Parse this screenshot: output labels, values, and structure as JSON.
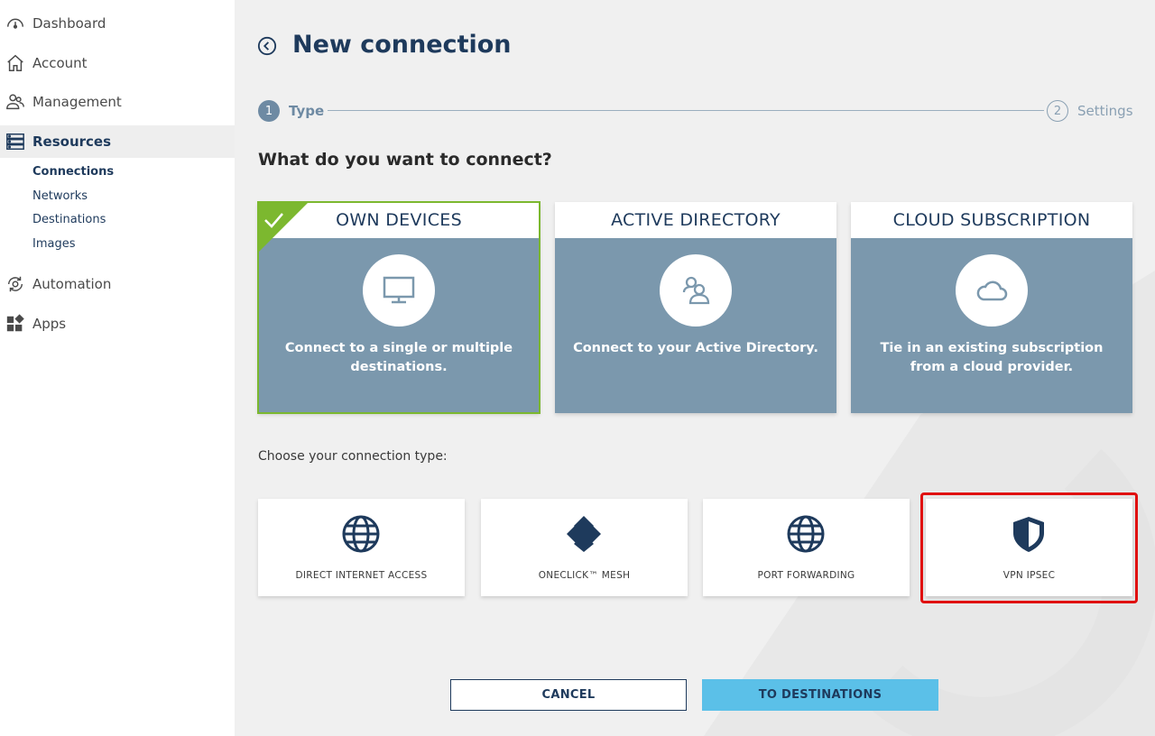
{
  "sidebar": {
    "items": [
      {
        "label": "Dashboard",
        "icon": "gauge-icon"
      },
      {
        "label": "Account",
        "icon": "home-icon"
      },
      {
        "label": "Management",
        "icon": "users-icon"
      },
      {
        "label": "Resources",
        "icon": "server-icon",
        "active": true
      },
      {
        "label": "Automation",
        "icon": "automation-icon"
      },
      {
        "label": "Apps",
        "icon": "apps-icon"
      }
    ],
    "sub_items": [
      {
        "label": "Connections",
        "active": true
      },
      {
        "label": "Networks"
      },
      {
        "label": "Destinations"
      },
      {
        "label": "Images"
      }
    ]
  },
  "header": {
    "title": "New connection"
  },
  "steps": [
    {
      "number": "1",
      "label": "Type",
      "active": true
    },
    {
      "number": "2",
      "label": "Settings",
      "active": false
    }
  ],
  "question": "What do you want to connect?",
  "cards": [
    {
      "title": "OWN DEVICES",
      "description": "Connect to a single or multiple destinations.",
      "icon": "monitor-icon",
      "selected": true
    },
    {
      "title": "ACTIVE DIRECTORY",
      "description": "Connect to your Active Directory.",
      "icon": "users-icon",
      "selected": false
    },
    {
      "title": "CLOUD SUBSCRIPTION",
      "description": "Tie in an existing subscription from a cloud provider.",
      "icon": "cloud-icon",
      "selected": false
    }
  ],
  "choose_label": "Choose your connection type:",
  "connection_types": [
    {
      "label": "DIRECT INTERNET ACCESS",
      "icon": "globe-icon"
    },
    {
      "label": "ONECLICK™ MESH",
      "icon": "mesh-icon"
    },
    {
      "label": "PORT FORWARDING",
      "icon": "globe-icon"
    },
    {
      "label": "VPN IPSEC",
      "icon": "shield-icon",
      "highlighted": true
    }
  ],
  "buttons": {
    "cancel": "CANCEL",
    "next": "TO DESTINATIONS"
  },
  "colors": {
    "primary": "#1e3a5c",
    "card_body": "#7b98ad",
    "selected_check": "#7cb82f",
    "next_button": "#5bc0e8",
    "highlight": "#e01010"
  }
}
